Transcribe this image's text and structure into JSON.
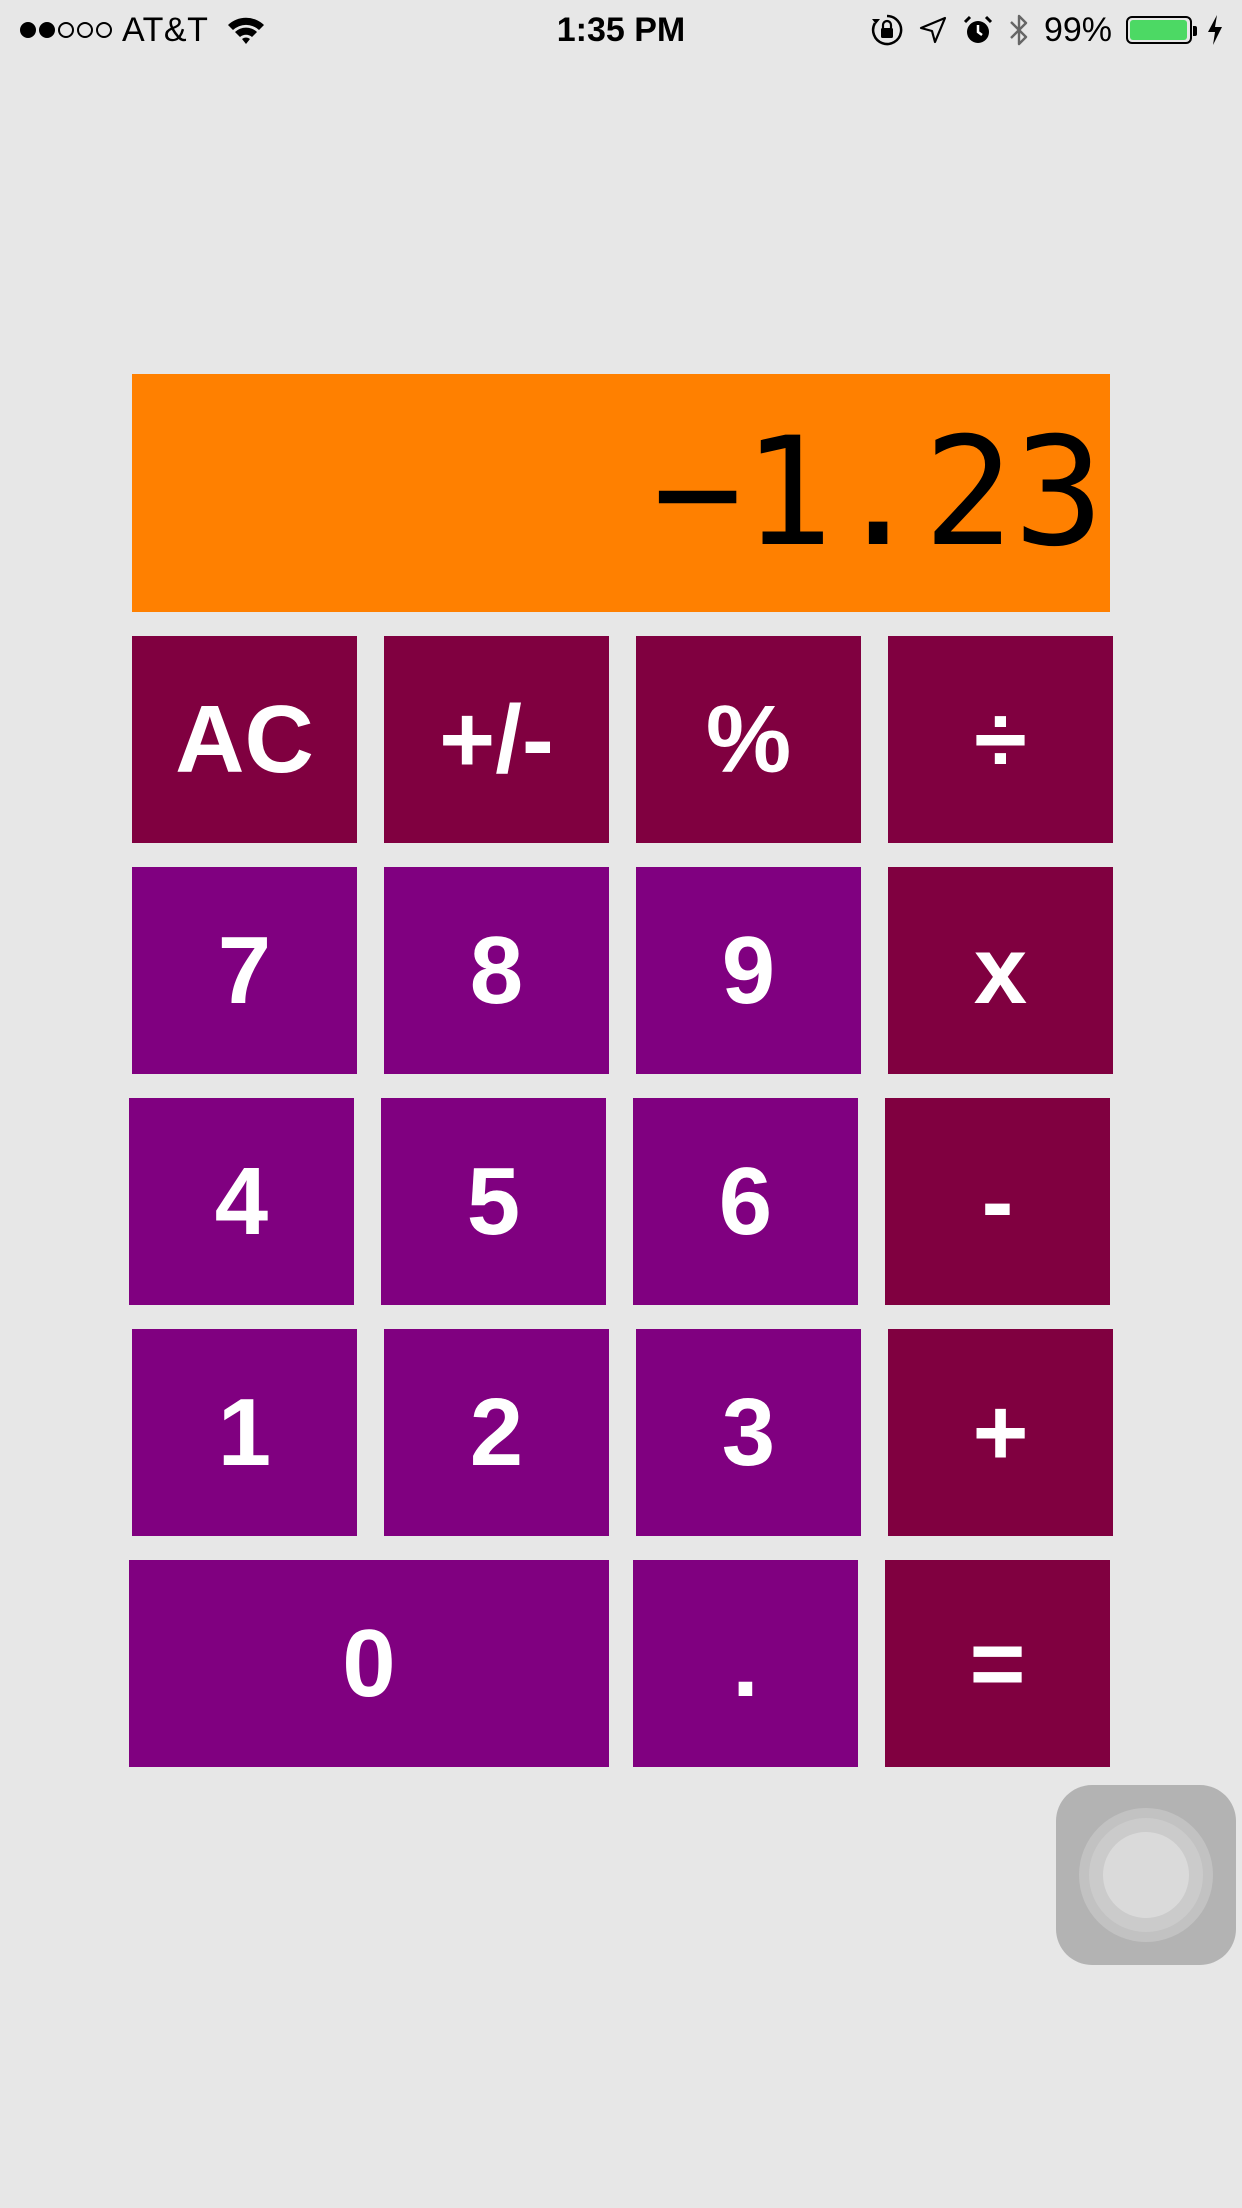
{
  "status_bar": {
    "carrier": "AT&T",
    "signal_bars": 2,
    "signal_total": 5,
    "time": "1:35 PM",
    "battery_percent": "99%",
    "battery_level": 0.99,
    "battery_color": "#4cd964",
    "icons": [
      "wifi-icon",
      "orientation-lock-icon",
      "location-icon",
      "alarm-icon",
      "bluetooth-icon",
      "battery-icon",
      "charging-icon"
    ]
  },
  "calculator": {
    "display": "−1.23",
    "display_color": "#ff8000",
    "number_key_color": "#800080",
    "operator_key_color": "#800040",
    "keys": {
      "ac": "AC",
      "sign": "+/-",
      "percent": "%",
      "divide": "÷",
      "seven": "7",
      "eight": "8",
      "nine": "9",
      "multiply": "x",
      "four": "4",
      "five": "5",
      "six": "6",
      "minus": "-",
      "one": "1",
      "two": "2",
      "three": "3",
      "plus": "+",
      "zero": "0",
      "decimal": ".",
      "equals": "="
    }
  },
  "assistive_touch": {
    "icon": "assistive-touch-icon"
  }
}
